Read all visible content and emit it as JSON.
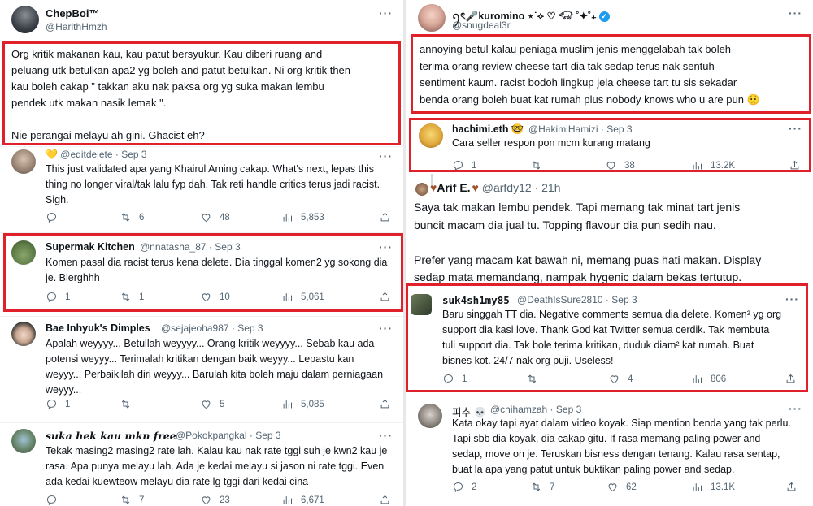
{
  "left": {
    "main": {
      "name": "ChepBoi™",
      "handle": "@HarithHmzh",
      "lines": [
        "Org kritik makanan kau, kau patut bersyukur. Kau diberi ruang and",
        "peluang utk betulkan apa2 yg boleh and patut betulkan. Ni org kritik then",
        "kau boleh cakap \" takkan aku nak paksa org yg suka makan lembu",
        "pendek utk makan nasik lemak \".",
        "",
        "Nie perangai melayu ah gini. Ghacist eh?"
      ]
    },
    "replies": [
      {
        "name": "",
        "handle": "@editdelete",
        "date": "Sep 3",
        "lines": [
          "This just validated apa yang Khairul Aming cakap. What's next, lepas this",
          "thing no longer viral/tak lalu fyp dah. Tak reti handle critics terus jadi racist.",
          "Sigh."
        ],
        "reply": "",
        "retweet": "6",
        "like": "48",
        "views": "5,853"
      },
      {
        "name": "Supermak Kitchen",
        "handle": "@nnatasha_87",
        "date": "Sep 3",
        "lines": [
          "Komen pasal dia racist terus kena delete. Dia tinggal komen2 yg sokong dia",
          "je. Blerghhh"
        ],
        "reply": "1",
        "retweet": "1",
        "like": "10",
        "views": "5,061"
      },
      {
        "name": "Bae Inhyuk's Dimples",
        "handle": "@sejajeoha987",
        "date": "Sep 3",
        "lines": [
          "Apalah weyyyy... Betullah weyyyy... Orang kritik weyyyy... Sebab kau ada",
          "potensi weyyy... Terimalah kritikan dengan baik weyyy... Lepastu kan",
          "weyyy... Perbaikilah diri weyyy... Barulah kita boleh maju dalam perniagaan",
          "weyyy..."
        ],
        "reply": "1",
        "retweet": "",
        "like": "5",
        "views": "5,085"
      },
      {
        "name": "suka hek kau mkn free",
        "handle": "@Pokokpangkal",
        "date": "Sep 3",
        "lines": [
          "Tekak masing2 masing2 rate lah. Kalau kau nak rate tggi suh je kwn2 kau je",
          "rasa. Apa punya melayu lah. Ada je kedai melayu si jason ni rate tggi. Even",
          "ada kedai kuewteow melayu dia rate lg tggi dari kedai cina"
        ],
        "reply": "",
        "retweet": "7",
        "like": "23",
        "views": "6,671"
      }
    ]
  },
  "right": {
    "main": {
      "name": "ꪆৎ🎤kuromino ⋆˙⟡ ♡ 𓃟 ˚✦˚₊",
      "handle": "@snugdeal3r",
      "lines": [
        "annoying betul kalau peniaga muslim jenis menggelabah tak boleh",
        "terima orang review cheese tart dia tak sedap terus nak sentuh",
        "sentiment kaum. racist bodoh lingkup jela cheese tart tu sis sekadar",
        "benda orang boleh buat kat rumah plus nobody knows who u are pun 😟"
      ]
    },
    "hachimi": {
      "name": "hachimi.eth 🤓",
      "handle": "@HakimiHamizi",
      "date": "Sep 3",
      "lines": [
        "Cara seller respon pon mcm kurang matang"
      ],
      "reply": "1",
      "retweet": "",
      "like": "38",
      "views": "13.2K"
    },
    "arif": {
      "name": "Arif E.",
      "handle": "@arfdy12",
      "date": "21h",
      "lines": [
        "Saya tak makan lembu pendek. Tapi memang tak minat tart jenis",
        "buncit macam dia jual tu. Topping flavour dia pun sedih nau.",
        "",
        "Prefer yang macam kat bawah ni, memang puas hati makan. Display",
        "sedap mata memandang, nampak hygenic dalam bekas tertutup."
      ]
    },
    "suk": {
      "name": "suk4sh1my85",
      "handle": "@DeathIsSure2810",
      "date": "Sep 3",
      "lines": [
        "Baru singgah TT dia. Negative comments semua dia delete. Komen² yg org",
        "support dia kasi love. Thank God kat Twitter semua cerdik. Tak membuta",
        "tuli support dia. Tak bole terima kritikan, duduk diam² kat rumah. Buat",
        "bisnes kot. 24/7 nak org puji. Useless!"
      ],
      "reply": "1",
      "retweet": "",
      "like": "4",
      "views": "806"
    },
    "pichu": {
      "name": "피추 💀",
      "handle": "@chihamzah",
      "date": "Sep 3",
      "lines": [
        "Kata okay tapi ayat dalam video koyak. Siap mention benda yang tak perlu.",
        "Tapi sbb dia koyak, dia cakap gitu. If rasa memang paling power and",
        "sedap, move on je. Teruskan bisness dengan tenang. Kalau rasa sentap,",
        "buat la apa yang patut untuk buktikan paling power and sedap."
      ],
      "reply": "2",
      "retweet": "7",
      "like": "62",
      "views": "13.1K"
    }
  },
  "colors": {
    "highlight": "#e0202a",
    "verified": "#1d9bf0",
    "muted": "#536471"
  }
}
